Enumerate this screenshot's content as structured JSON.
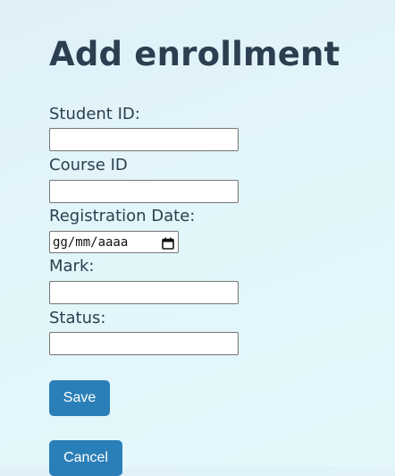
{
  "page": {
    "title": "Add enrollment"
  },
  "form": {
    "student_id": {
      "label": "Student ID:",
      "value": ""
    },
    "course_id": {
      "label": "Course ID",
      "value": ""
    },
    "registration_date": {
      "label": "Registration Date:",
      "placeholder": "gg/mm/aaaa"
    },
    "mark": {
      "label": "Mark:",
      "value": ""
    },
    "status": {
      "label": "Status:",
      "value": ""
    }
  },
  "actions": {
    "save_label": "Save",
    "cancel_label": "Cancel"
  },
  "colors": {
    "background": "#e2f5fa",
    "heading": "#2c3e50",
    "button": "#2b7fb8"
  },
  "icons": {
    "date_picker": "calendar-icon"
  }
}
